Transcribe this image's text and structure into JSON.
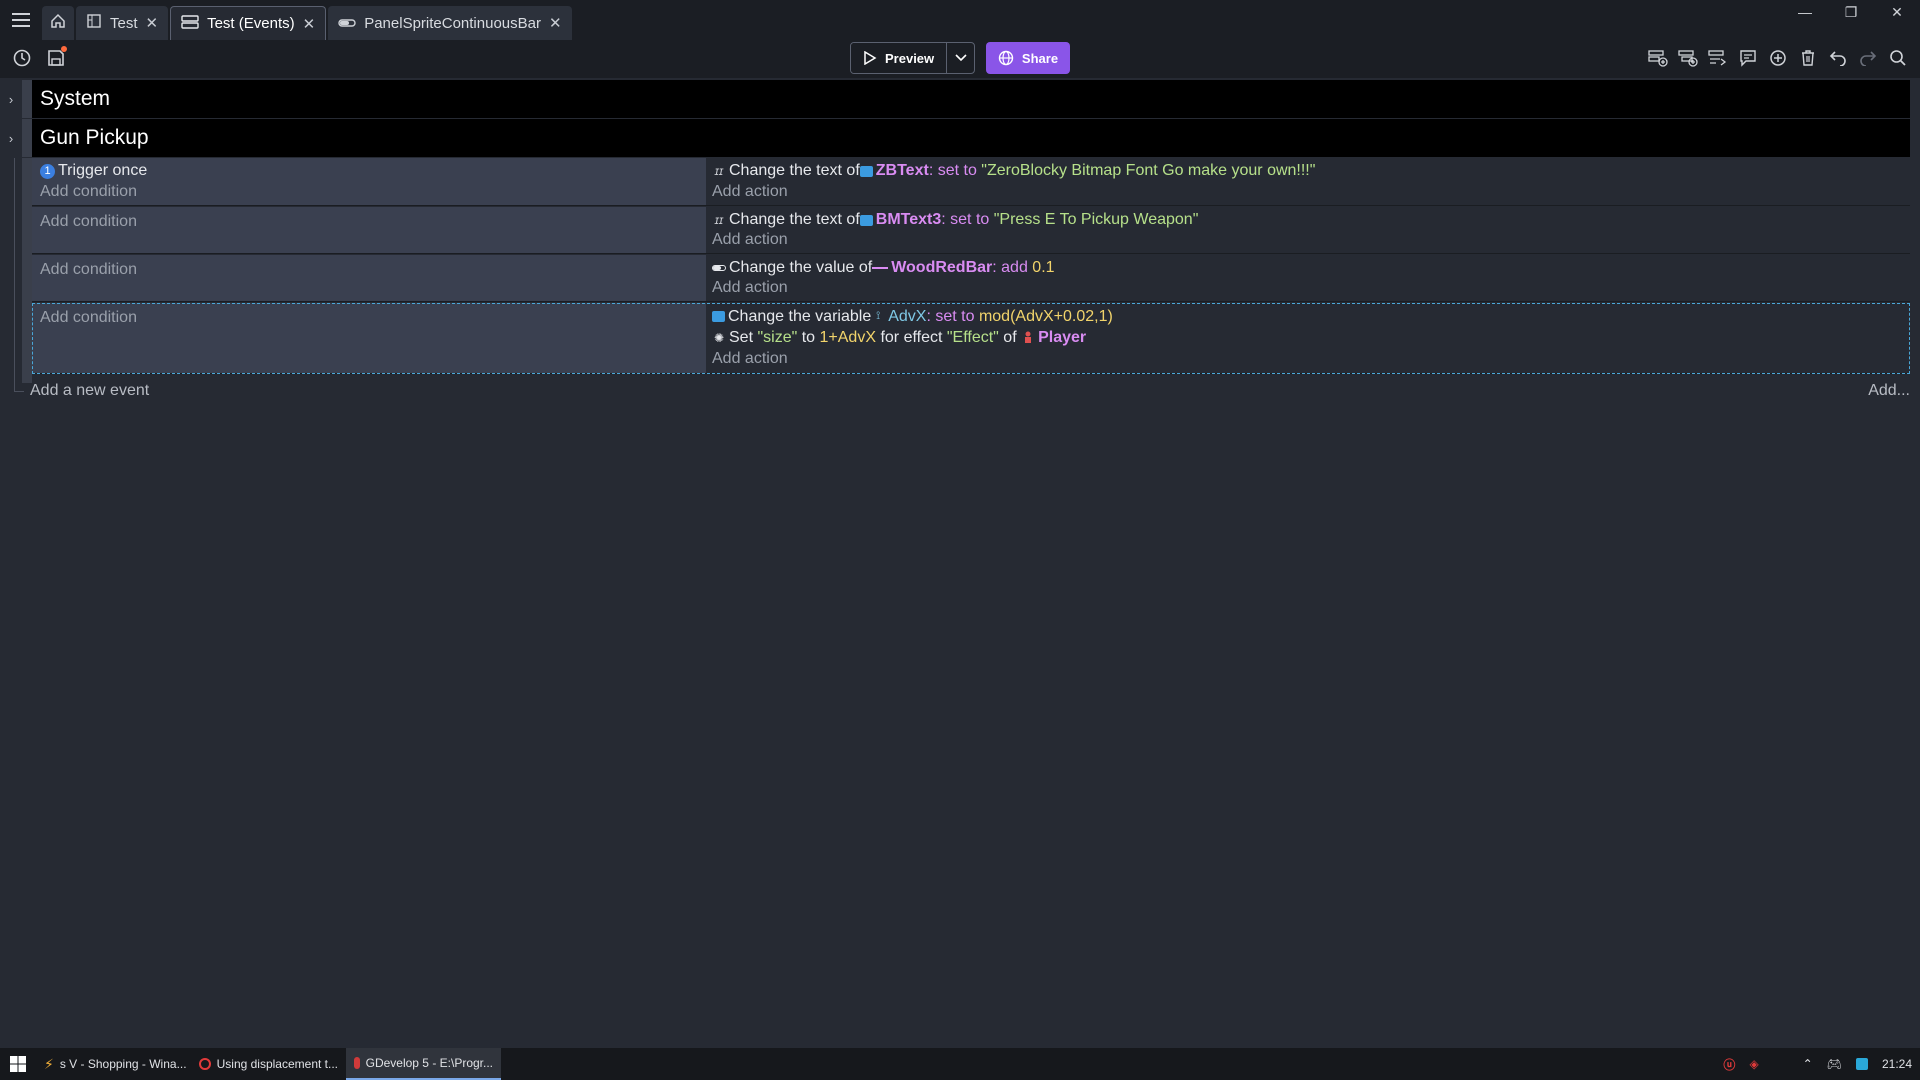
{
  "tabs": [
    {
      "label": "Test",
      "icon": "scene-icon"
    },
    {
      "label": "Test (Events)",
      "icon": "events-icon",
      "active": true
    },
    {
      "label": "PanelSpriteContinuousBar",
      "icon": "bar-icon"
    }
  ],
  "toolbar": {
    "preview_label": "Preview",
    "share_label": "Share"
  },
  "groups": [
    {
      "title": "System"
    },
    {
      "title": "Gun Pickup"
    }
  ],
  "events": [
    {
      "conditions": [
        "Trigger once"
      ],
      "add_condition": "Add condition",
      "action1": {
        "prefix": "Change the text of ",
        "object": "ZBText",
        "op": ": set to ",
        "value": "\"ZeroBlocky Bitmap Font Go make your own!!!\""
      },
      "add_action": "Add action"
    },
    {
      "add_condition": "Add condition",
      "action1": {
        "prefix": "Change the text of ",
        "object": "BMText3",
        "op": ": set to ",
        "value": "\"Press E To Pickup Weapon\""
      },
      "add_action": "Add action"
    },
    {
      "add_condition": "Add condition",
      "action1": {
        "prefix": "Change the value of ",
        "object": "WoodRedBar",
        "op": ": add ",
        "value": "0.1"
      },
      "add_action": "Add action"
    },
    {
      "add_condition": "Add condition",
      "action1": {
        "prefix": "Change the variable ",
        "var": "AdvX",
        "op": ": set to ",
        "value": "mod(AdvX+0.02,1)"
      },
      "action2": {
        "p1": "Set ",
        "s1": "\"size\"",
        "p2": " to ",
        "n1": "1+AdvX",
        "p3": " for effect ",
        "s2": "\"Effect\"",
        "p4": " of ",
        "object": "Player"
      },
      "add_action": "Add action"
    }
  ],
  "add_event": {
    "label": "Add a new event",
    "more": "Add..."
  },
  "taskbar": {
    "items": [
      {
        "label": "s V - Shopping - Wina..."
      },
      {
        "label": "Using displacement t..."
      },
      {
        "label": "GDevelop 5 - E:\\Progr..."
      }
    ],
    "clock": "21:24"
  },
  "colors": {
    "accent": "#8a55e8",
    "object": "#d98cf2",
    "string": "#b6e08a",
    "number": "#f2d46b",
    "variable": "#7fc9e6"
  }
}
